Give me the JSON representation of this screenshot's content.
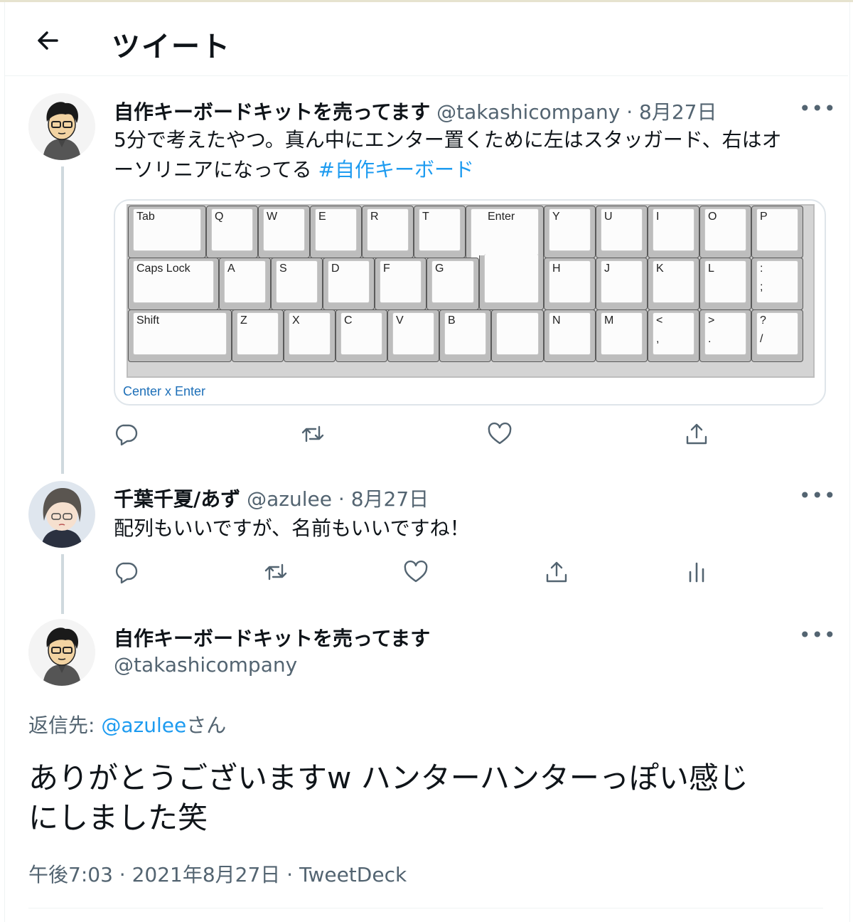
{
  "header": {
    "title": "ツイート"
  },
  "tweet1": {
    "name": "自作キーボードキットを売ってます",
    "handle": "@takashicompany",
    "dot": "·",
    "date": "8月27日",
    "text_line1": "5分で考えたやつ。真ん中にエンター置くために左はスタッガード、右はオ",
    "text_line2_prefix": "ーソリニアになってる ",
    "hashtag": "#自作キーボード",
    "card_caption": "Center x Enter",
    "keys": {
      "tab": "Tab",
      "q": "Q",
      "w": "W",
      "e": "E",
      "r": "R",
      "t": "T",
      "enter": "Enter",
      "y": "Y",
      "u": "U",
      "i": "I",
      "o": "O",
      "p": "P",
      "caps": "Caps Lock",
      "a": "A",
      "s": "S",
      "d": "D",
      "f": "F",
      "g": "G",
      "h": "H",
      "j": "J",
      "k": "K",
      "l": "L",
      "colon": ":",
      "semicolon": ";",
      "shift": "Shift",
      "z": "Z",
      "x": "X",
      "c": "C",
      "v": "V",
      "b": "B",
      "n": "N",
      "m": "M",
      "lt": "<",
      "comma": ",",
      "gt": ">",
      "period": ".",
      "question": "?",
      "slash": "/"
    }
  },
  "tweet2": {
    "name": "千葉千夏/あず",
    "handle": "@azulee",
    "dot": "·",
    "date": "8月27日",
    "text": "配列もいいですが、名前もいいですね！"
  },
  "tweet3": {
    "name": "自作キーボードキットを売ってます",
    "handle": "@takashicompany",
    "reply_prefix": "返信先: ",
    "reply_handle": "@azulee",
    "reply_suffix": "さん",
    "text_line1": "ありがとうございますw ハンターハンターっぽい感じ",
    "text_line2": "にしました笑",
    "meta": "午後7:03 · 2021年8月27日 · TweetDeck"
  },
  "more_label": "•••",
  "colors": {
    "accent": "#1d9bf0",
    "muted": "#536471",
    "text": "#0f1419"
  }
}
